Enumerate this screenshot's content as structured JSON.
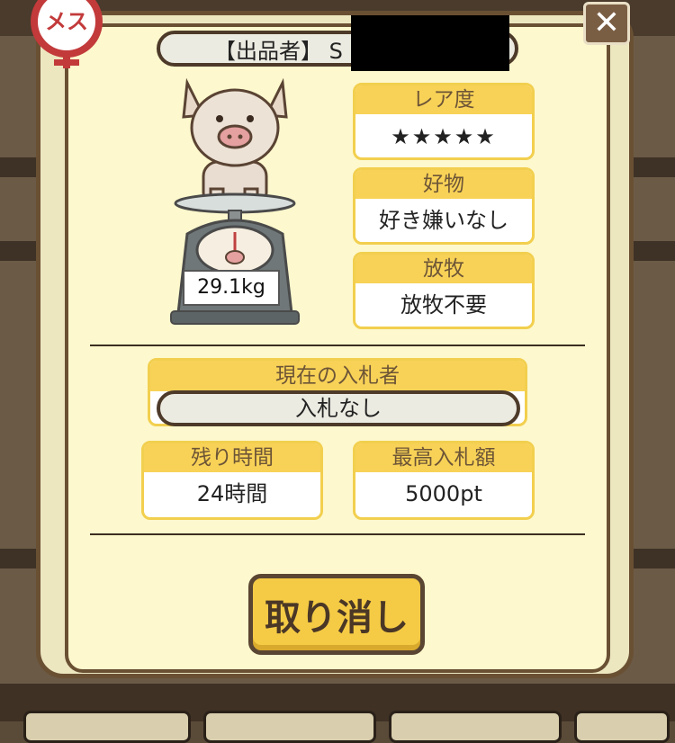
{
  "badge": {
    "label": "メス",
    "icon": "female-symbol-icon"
  },
  "close": {
    "label": "✕",
    "icon": "close-icon"
  },
  "seller": {
    "text": "【出品者】 S"
  },
  "pig": {
    "weight": "29.1kg",
    "icon": "pig-icon"
  },
  "rarity": {
    "label": "レア度",
    "stars": "★★★★★",
    "value": 5,
    "max": 5
  },
  "favorite": {
    "label": "好物",
    "value": "好き嫌いなし"
  },
  "grazing": {
    "label": "放牧",
    "value": "放牧不要"
  },
  "current_bidder": {
    "label": "現在の入札者",
    "value": "入札なし"
  },
  "time_left": {
    "label": "残り時間",
    "value": "24時間"
  },
  "highest_bid": {
    "label": "最高入札額",
    "value": "5000pt"
  },
  "cancel_button": {
    "label": "取り消し"
  },
  "colors": {
    "accent": "#f8d257",
    "border": "#6a5033",
    "panel": "#fdf8cd",
    "star": "#e0787d"
  }
}
